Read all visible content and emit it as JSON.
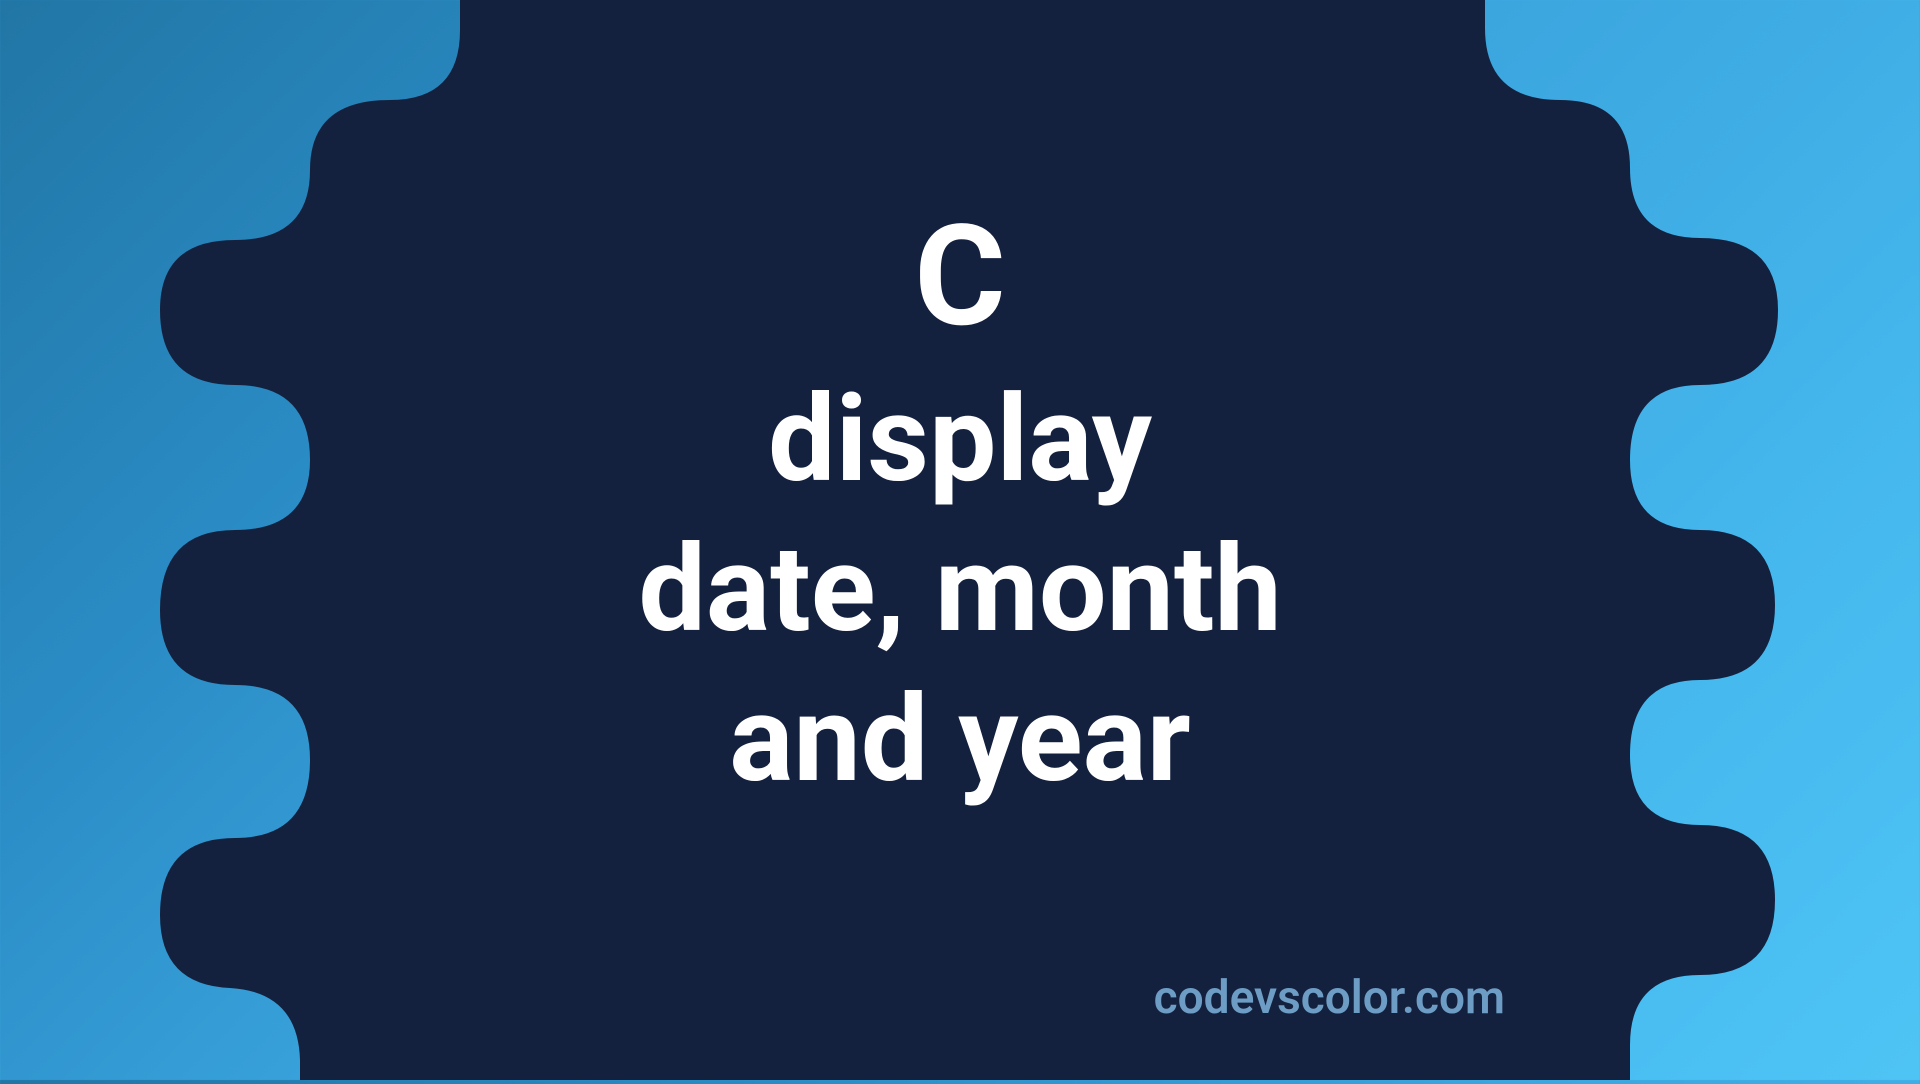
{
  "title": {
    "line1": "C",
    "line2": "display",
    "line3": "date, month",
    "line4": "and year"
  },
  "watermark": "codevscolor.com",
  "colors": {
    "blob": "#14213e",
    "text": "#ffffff",
    "watermark": "#6d9dc5",
    "gradient_start": "#2176a5",
    "gradient_end": "#4ec4f5"
  }
}
